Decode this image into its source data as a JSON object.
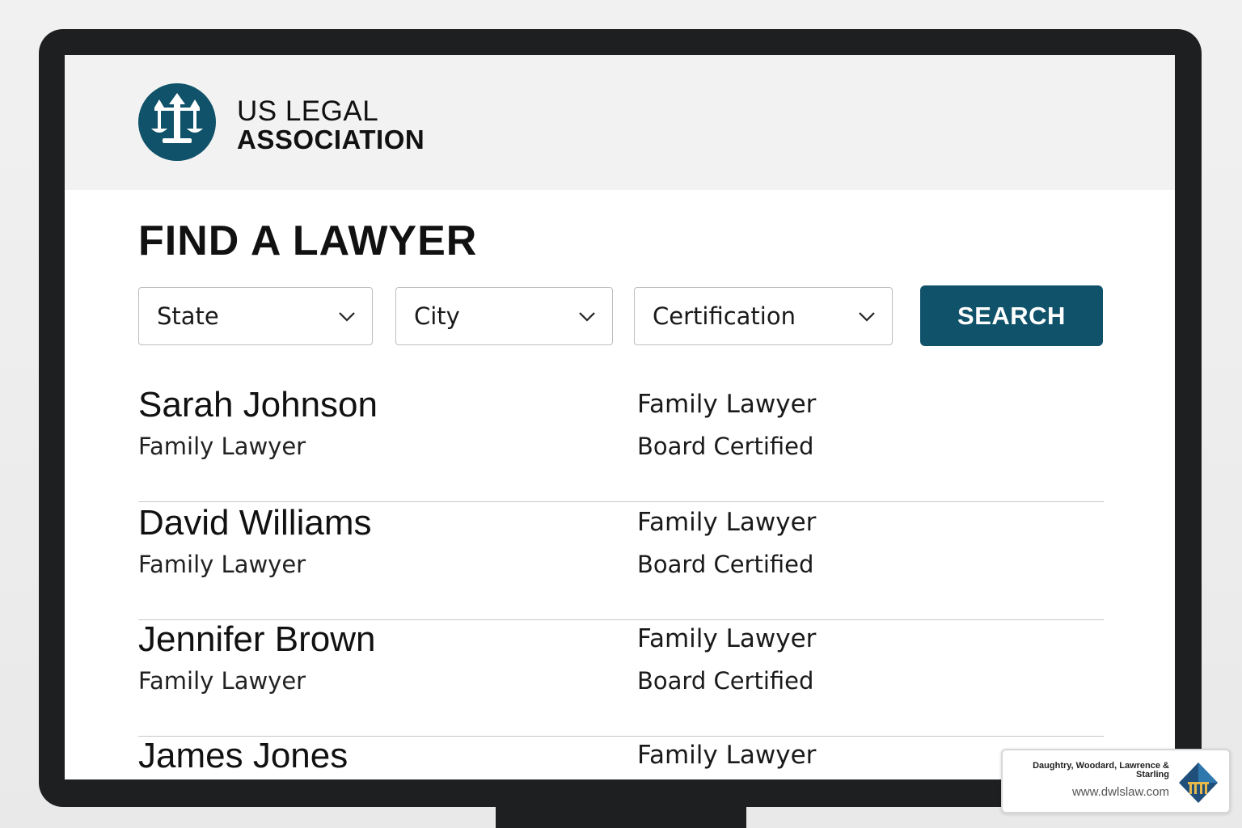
{
  "header": {
    "brand_line1": "US LEGAL",
    "brand_line2": "ASSOCIATION",
    "logo_icon": "scales-of-justice-icon",
    "brand_color": "#0f5269"
  },
  "main": {
    "title": "FIND A LAWYER",
    "filters": {
      "state": "State",
      "city": "City",
      "certification": "Certification"
    },
    "search_label": "SEARCH"
  },
  "results": [
    {
      "name": "Sarah Johnson",
      "subtitle": "Family Lawyer",
      "specialty": "Family Lawyer",
      "certification": "Board Certified"
    },
    {
      "name": "David Williams",
      "subtitle": "Family Lawyer",
      "specialty": "Family Lawyer",
      "certification": "Board Certified"
    },
    {
      "name": "Jennifer Brown",
      "subtitle": "Family Lawyer",
      "specialty": "Family Lawyer",
      "certification": "Board Certified"
    },
    {
      "name": "James Jones",
      "specialty": "Family Lawyer"
    }
  ],
  "watermark": {
    "firm": "Daughtry, Woodard, Lawrence & Starling",
    "url": "www.dwlslaw.com"
  }
}
